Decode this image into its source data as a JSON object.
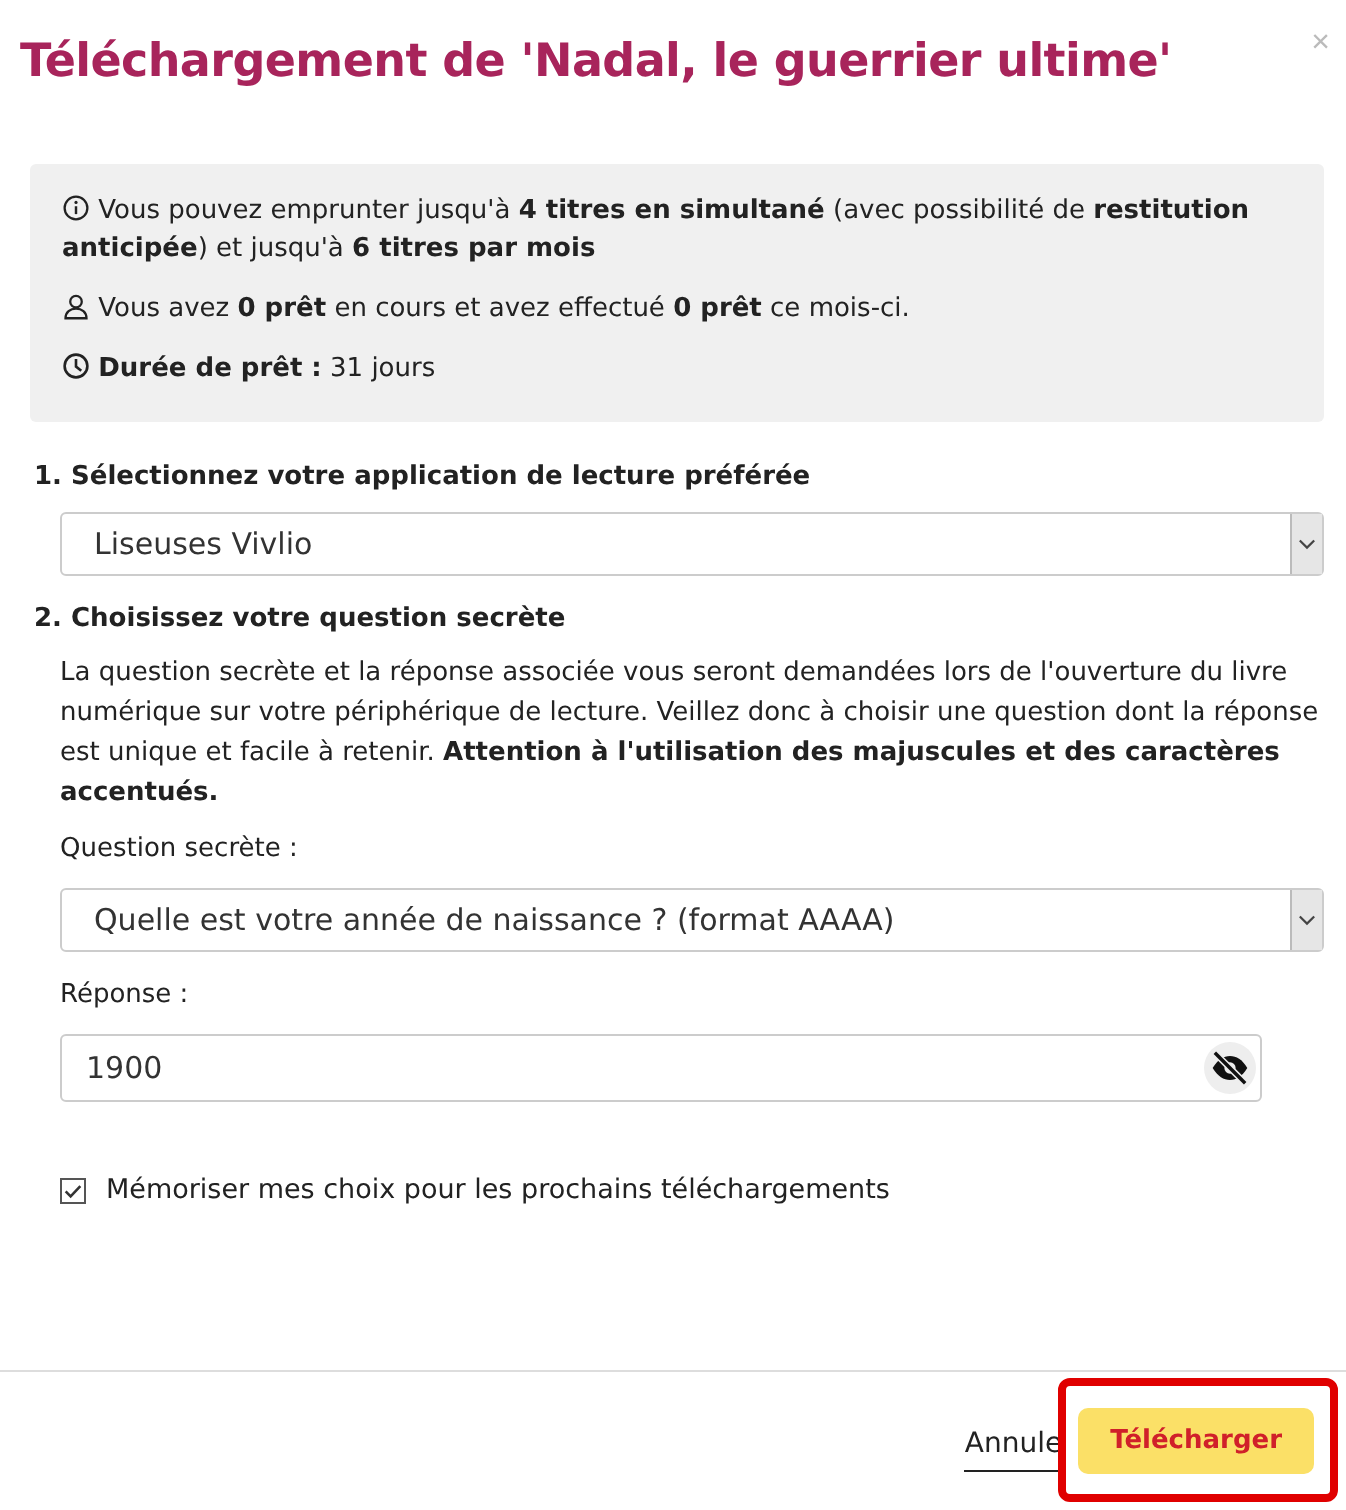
{
  "dialog": {
    "title": "Téléchargement de 'Nadal, le guerrier ultime'",
    "close": "×"
  },
  "info": [
    {
      "kind": "info",
      "text": "Vous pouvez emprunter jusqu'à **4 titres en simultané** (avec possibilité de **restitution anticipée**) et jusqu'à **6 titres par mois**"
    },
    {
      "kind": "user",
      "text": "Vous avez **0 prêt** en cours et avez effectué **0 prêt** ce mois-ci."
    },
    {
      "kind": "clock",
      "text": "**Durée de prêt :** 31 jours"
    }
  ],
  "step1": {
    "heading": "1. Sélectionnez votre application de lecture préférée",
    "select_value": "Liseuses Vivlio"
  },
  "step2": {
    "heading": "2. Choisissez votre question secrète",
    "description": "La question secrète et la réponse associée vous seront demandées lors de l'ouverture du livre numérique sur votre périphérique de lecture. Veillez donc à choisir une question dont la réponse est unique et facile à retenir. **Attention à l'utilisation des majuscules et des caractères accentués.**",
    "question_label": "Question secrète :",
    "question_value": "Quelle est votre année de naissance ? (format AAAA)",
    "answer_label": "Réponse :",
    "answer_value": "1900"
  },
  "remember": {
    "label": "Mémoriser mes choix pour les prochains téléchargements",
    "checked": true
  },
  "footer": {
    "cancel": "Annule",
    "download": "Télécharger",
    "download_highlighted": true
  }
}
